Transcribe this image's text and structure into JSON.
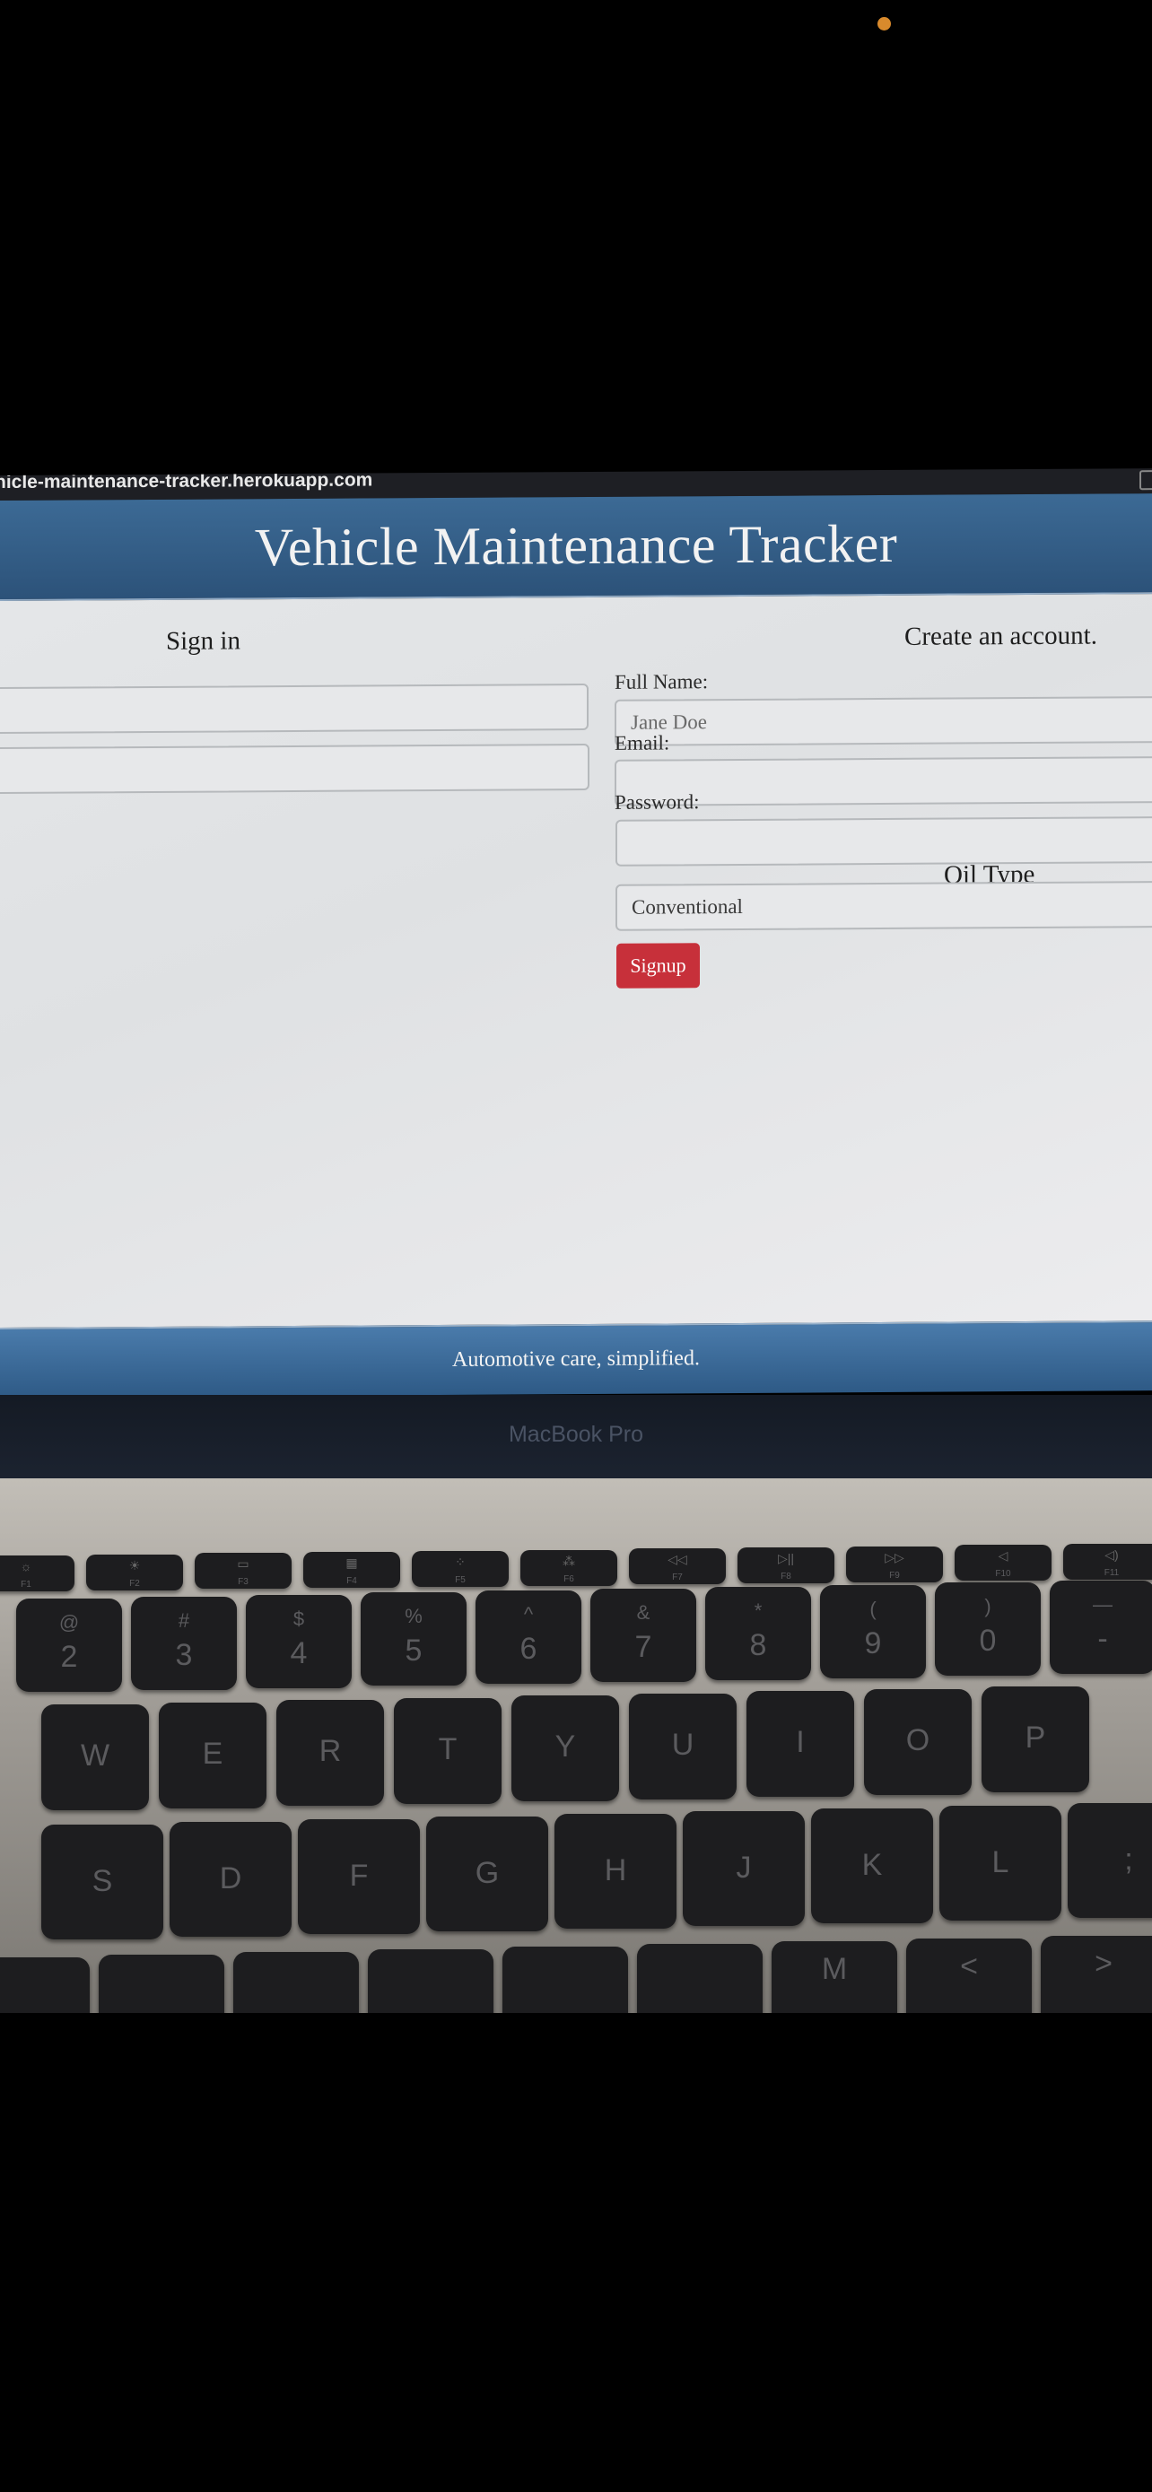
{
  "browser": {
    "url": "hicle-maintenance-tracker.herokuapp.com"
  },
  "header": {
    "title": "Vehicle Maintenance Tracker"
  },
  "signin": {
    "heading": "Sign in"
  },
  "signup": {
    "heading": "Create an account.",
    "full_name_label": "Full Name:",
    "full_name_placeholder": "Jane Doe",
    "email_label": "Email:",
    "password_label": "Password:",
    "oil_type_label": "Oil Type",
    "oil_type_value": "Conventional",
    "button_label": "Signup"
  },
  "footer": {
    "tagline": "Automotive care, simplified."
  },
  "laptop": {
    "brand": "MacBook Pro"
  },
  "keyboard": {
    "fn_row": [
      {
        "icon": "☼",
        "label": "F1"
      },
      {
        "icon": "☀",
        "label": "F2"
      },
      {
        "icon": "▭",
        "label": "F3"
      },
      {
        "icon": "▦",
        "label": "F4"
      },
      {
        "icon": "⁘",
        "label": "F5"
      },
      {
        "icon": "⁂",
        "label": "F6"
      },
      {
        "icon": "◁◁",
        "label": "F7"
      },
      {
        "icon": "▷||",
        "label": "F8"
      },
      {
        "icon": "▷▷",
        "label": "F9"
      },
      {
        "icon": "◁",
        "label": "F10"
      },
      {
        "icon": "◁)",
        "label": "F11"
      }
    ],
    "num_row": [
      {
        "top": "@",
        "main": "2"
      },
      {
        "top": "#",
        "main": "3"
      },
      {
        "top": "$",
        "main": "4"
      },
      {
        "top": "%",
        "main": "5"
      },
      {
        "top": "^",
        "main": "6"
      },
      {
        "top": "&",
        "main": "7"
      },
      {
        "top": "*",
        "main": "8"
      },
      {
        "top": "(",
        "main": "9"
      },
      {
        "top": ")",
        "main": "0"
      },
      {
        "top": "—",
        "main": "-"
      }
    ],
    "q_row": [
      "W",
      "E",
      "R",
      "T",
      "Y",
      "U",
      "I",
      "O",
      "P"
    ],
    "a_row": [
      "S",
      "D",
      "F",
      "G",
      "H",
      "J",
      "K",
      "L",
      ";"
    ],
    "z_row": [
      "",
      "",
      "",
      "",
      "",
      "",
      "M",
      "<",
      ">"
    ]
  }
}
